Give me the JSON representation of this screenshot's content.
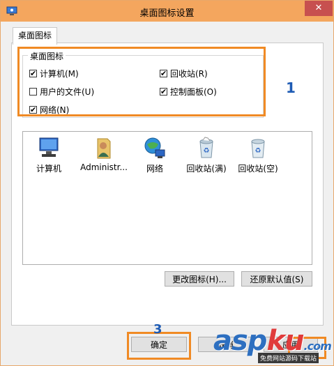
{
  "window": {
    "title": "桌面图标设置",
    "close_glyph": "✕"
  },
  "tab": {
    "label": "桌面图标"
  },
  "group": {
    "label": "桌面图标",
    "checkboxes": [
      {
        "label": "计算机(M)",
        "checked": true
      },
      {
        "label": "回收站(R)",
        "checked": true
      },
      {
        "label": "用户的文件(U)",
        "checked": false
      },
      {
        "label": "控制面板(O)",
        "checked": true
      },
      {
        "label": "网络(N)",
        "checked": true
      }
    ]
  },
  "icons": [
    {
      "label": "计算机",
      "icon": "computer-icon"
    },
    {
      "label": "Administr...",
      "icon": "user-folder-icon"
    },
    {
      "label": "网络",
      "icon": "network-icon"
    },
    {
      "label": "回收站(满)",
      "icon": "recycle-bin-full-icon"
    },
    {
      "label": "回收站(空)",
      "icon": "recycle-bin-empty-icon"
    }
  ],
  "buttons": {
    "change_icon": "更改图标(H)...",
    "restore_default": "还原默认值(S)",
    "ok": "确定",
    "cancel": "取消",
    "apply": "应用"
  },
  "annotations": {
    "one": "1",
    "three": "3"
  },
  "watermark": {
    "main_a": "asp",
    "main_b": "ku",
    "tail": ".com",
    "sub": "免费网站源码下载站"
  },
  "colors": {
    "titlebar": "#f4a65e",
    "highlight": "#f08a24",
    "annotation": "#1e5bb4",
    "close": "#c7504f"
  }
}
